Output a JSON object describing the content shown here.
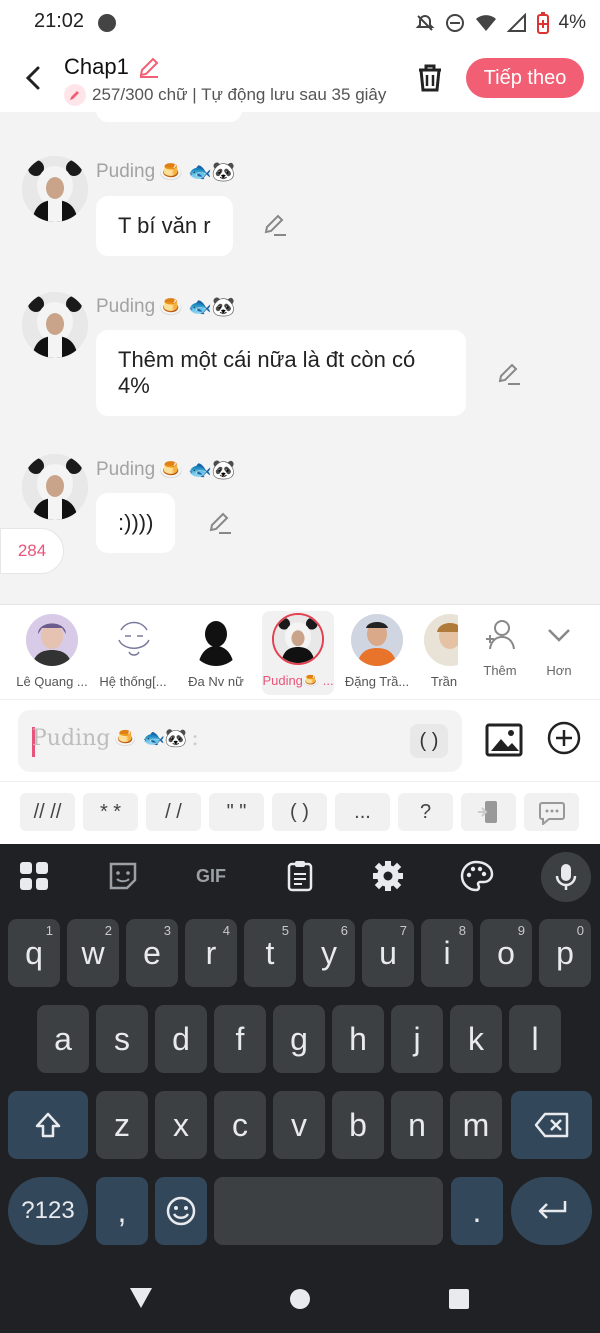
{
  "status_bar": {
    "time": "21:02",
    "battery_pct": "4%"
  },
  "header": {
    "title": "Chap1",
    "subtitle": "257/300 chữ | Tự động lưu sau 35 giây",
    "next_button": "Tiếp theo"
  },
  "chat": {
    "messages": [
      {
        "name": "Puding",
        "text": "T bí văn r"
      },
      {
        "name": "Puding",
        "text": "Thêm một cái nữa là đt còn có 4%"
      },
      {
        "name": "Puding",
        "text": ":))))"
      }
    ],
    "counter": "284"
  },
  "characters": [
    {
      "label": "Lê Quang ..."
    },
    {
      "label": "Hệ thống[..."
    },
    {
      "label": "Đa Nv nữ"
    },
    {
      "label": "Puding🍮 ..."
    },
    {
      "label": "Đặng Trầ..."
    },
    {
      "label": "Trần"
    }
  ],
  "char_actions": {
    "add": "Thêm",
    "more": "Hơn"
  },
  "input": {
    "placeholder": "Puding",
    "paren_button": "( )"
  },
  "quick_keys": [
    "// //",
    "* *",
    "/ /",
    "\" \"",
    "( )",
    "...",
    "?"
  ],
  "keyboard": {
    "toolbar": [
      "grid-icon",
      "sticker-icon",
      "gif-icon",
      "clipboard-icon",
      "settings-icon",
      "palette-icon",
      "mic-icon"
    ],
    "gif_label": "GIF",
    "row1": [
      "q",
      "w",
      "e",
      "r",
      "t",
      "y",
      "u",
      "i",
      "o",
      "p"
    ],
    "row1_digits": [
      "1",
      "2",
      "3",
      "4",
      "5",
      "6",
      "7",
      "8",
      "9",
      "0"
    ],
    "row2": [
      "a",
      "s",
      "d",
      "f",
      "g",
      "h",
      "j",
      "k",
      "l"
    ],
    "row3": [
      "z",
      "x",
      "c",
      "v",
      "b",
      "n",
      "m"
    ],
    "sym_key": "?123",
    "comma_key": ",",
    "period_key": "."
  },
  "colors": {
    "accent": "#f25f75",
    "keyboard_bg": "#202124",
    "key_bg": "#3c4043"
  }
}
